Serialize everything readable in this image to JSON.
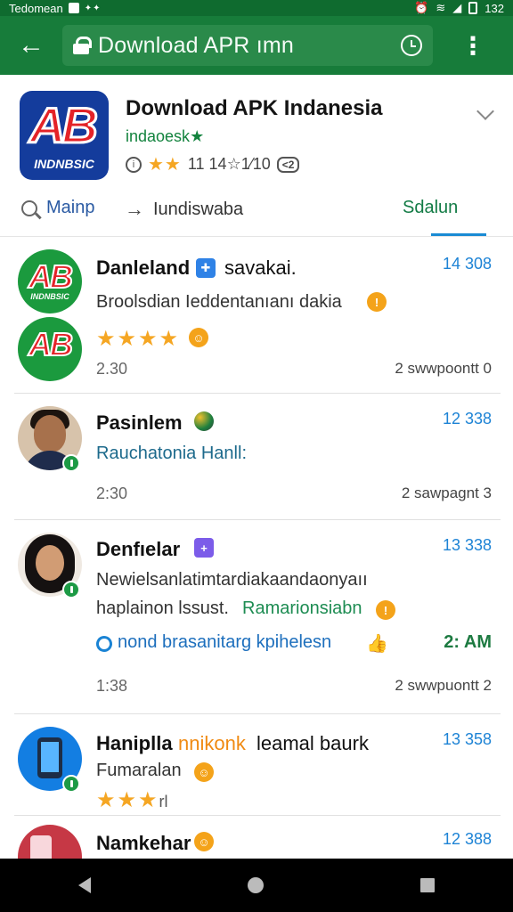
{
  "status_bar": {
    "left_label": "Tedomean",
    "right_label": "132"
  },
  "toolbar": {
    "url": "Download APR ımn"
  },
  "app": {
    "title": "Download APK Indanesia",
    "developer": "indaoesk",
    "rating_stars": "★★",
    "rating_text": "11 14☆1⁄10",
    "badge": "<2",
    "logo_letters": "AB",
    "logo_tag": "INDNBSIC"
  },
  "tabs": [
    {
      "label": "Mainp",
      "icon": "search-icon"
    },
    {
      "label": "Iundiswaba",
      "icon": "arrow-icon"
    },
    {
      "label": "Sdalun",
      "icon": ""
    }
  ],
  "items": [
    {
      "name": "Danleland",
      "name_suffix": "savakai.",
      "count": "14 308",
      "line1": "Broolsdian Ieddentanıanı dakia",
      "stars": "★★★★",
      "time": "2.30",
      "reply": "2 swwpoontt 0",
      "avatar": "app-logo"
    },
    {
      "name": "Pasinlem",
      "count": "12 338",
      "line1": "Rauchatonia Hanll:",
      "time": "2:30",
      "reply": "2 sawpagnt 3",
      "avatar": "person"
    },
    {
      "name": "Denfıelar",
      "count": "13 338",
      "line1": "Newielsanlatimtardiakaandaonyaıı",
      "line2_left": "haplainon lssust.",
      "line2_right": "Ramarionsiabn",
      "action_text": "nond  brasanitarg kpihelesn",
      "action_time": "2: AM",
      "time": "1:38",
      "reply": "2 swwpuontt 2",
      "avatar": "woman"
    },
    {
      "name": "Hanipllа",
      "name_suffix": "nnikonk",
      "name_suffix2": "leamal baurk",
      "count": "13 358",
      "line1": "Fumaralan",
      "stars": "★★★",
      "stars_suffix": "rl",
      "avatar": "phone"
    },
    {
      "name": "Namkehar",
      "count": "12 388",
      "avatar": "red"
    }
  ]
}
